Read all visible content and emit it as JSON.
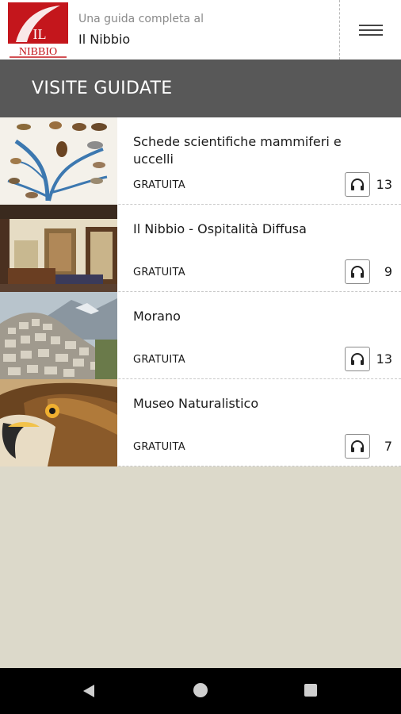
{
  "header": {
    "logo_text_top": "IL",
    "logo_text_bottom": "NIBBIO",
    "subtitle": "Una guida completa al",
    "title": "Il Nibbio"
  },
  "section": {
    "title": "VISITE GUIDATE"
  },
  "tours": [
    {
      "title": "Schede scientifiche mammiferi e uccelli",
      "price": "GRATUITA",
      "count": "13",
      "thumb": "animals-tree"
    },
    {
      "title": "Il Nibbio - Ospitalità Diffusa",
      "price": "GRATUITA",
      "count": "9",
      "thumb": "room-interior"
    },
    {
      "title": "Morano",
      "price": "GRATUITA",
      "count": "13",
      "thumb": "hill-town"
    },
    {
      "title": "Museo Naturalistico",
      "price": "GRATUITA",
      "count": "7",
      "thumb": "eagle"
    }
  ],
  "colors": {
    "section_bar": "#585858",
    "logo_red": "#c4161c",
    "background": "#dcd9ca"
  },
  "icons": {
    "menu": "hamburger-icon",
    "audio": "headphones-icon"
  }
}
